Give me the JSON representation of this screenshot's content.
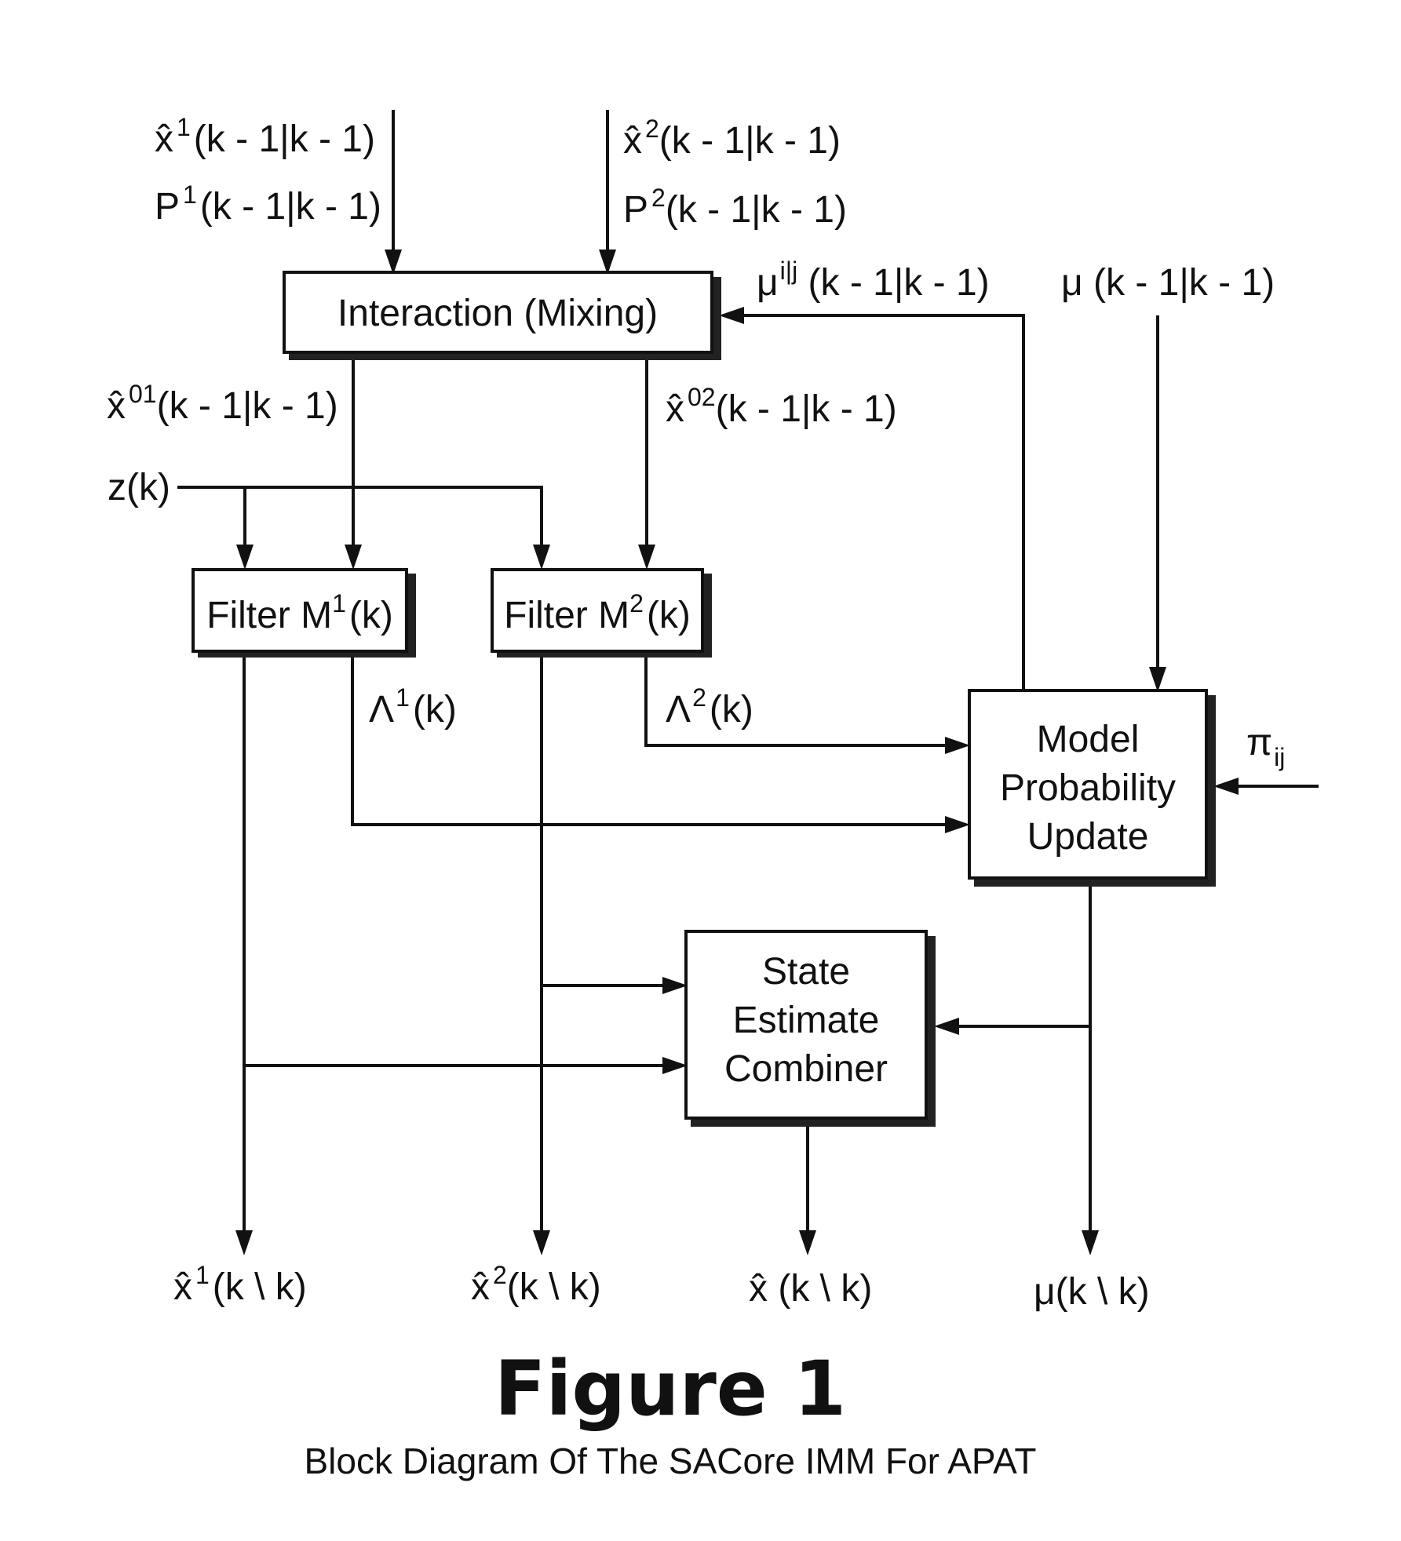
{
  "figure": {
    "title": "Figure 1",
    "caption": "Block Diagram Of The SACore IMM For APAT"
  },
  "blocks": {
    "interaction": {
      "label": "Interaction (Mixing)"
    },
    "filter1": {
      "base": "Filter M",
      "sup": "1",
      "arg": "(k)"
    },
    "filter2": {
      "base": "Filter M",
      "sup": "2",
      "arg": "(k)"
    },
    "model_update": {
      "lines": [
        "Model",
        "Probability",
        "Update"
      ]
    },
    "combiner": {
      "lines": [
        "State",
        "Estimate",
        "Combiner"
      ]
    }
  },
  "signals": {
    "x1_prev": {
      "base": "x̂",
      "sup": "1",
      "arg": "(k - 1|k - 1)"
    },
    "p1_prev": {
      "base": "P",
      "sup": "1",
      "arg": "(k - 1|k - 1)"
    },
    "x2_prev": {
      "base": "x̂",
      "sup": "2",
      "arg": "(k - 1|k - 1)"
    },
    "p2_prev": {
      "base": "P",
      "sup": "2",
      "arg": "(k - 1|k - 1)"
    },
    "mu_ij_prev": {
      "base": "μ",
      "sup": "i|j",
      "arg": " (k - 1|k - 1)"
    },
    "mu_prev": {
      "base": "μ",
      "arg": " (k - 1|k - 1)"
    },
    "x01": {
      "base": "x̂",
      "sup": "01",
      "arg": "(k - 1|k - 1)"
    },
    "x02": {
      "base": "x̂",
      "sup": "02",
      "arg": "(k - 1|k - 1)"
    },
    "z": {
      "text": "z(k)"
    },
    "lambda1": {
      "base": "Λ",
      "sup": "1",
      "arg": "(k)"
    },
    "lambda2": {
      "base": "Λ",
      "sup": "2",
      "arg": "(k)"
    },
    "pi": {
      "base": "π",
      "sub": "ij"
    },
    "x1_out": {
      "base": "x̂",
      "sup": "1",
      "arg": "(k \\ k)"
    },
    "x2_out": {
      "base": "x̂",
      "sup": "2",
      "arg": "(k \\ k)"
    },
    "x_out": {
      "base": "x̂",
      "arg": " (k \\ k)"
    },
    "mu_out": {
      "base": "μ",
      "arg": "(k \\ k)"
    }
  },
  "colors": {
    "ink": "#111111",
    "background": "#ffffff"
  }
}
